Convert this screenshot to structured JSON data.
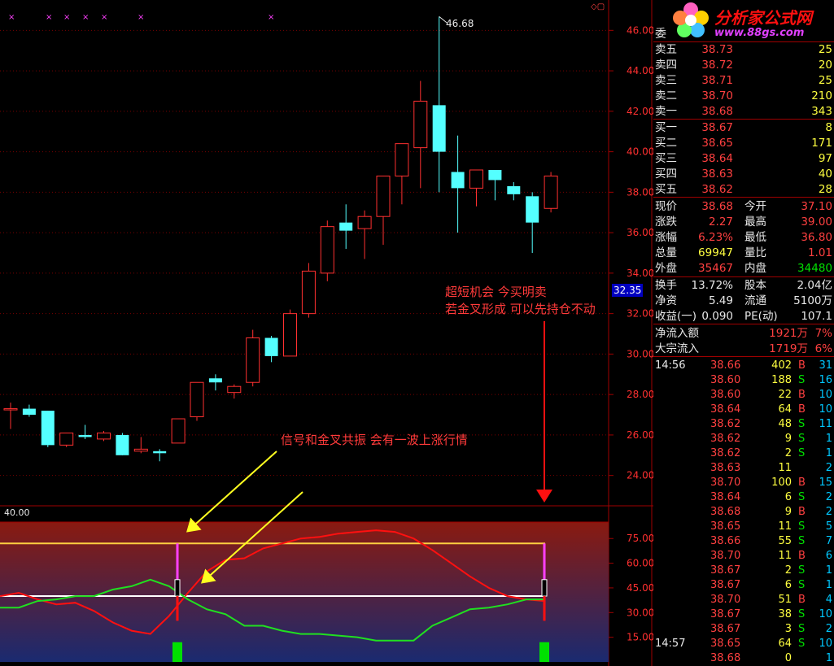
{
  "upper_axis": [
    "46.00",
    "44.00",
    "42.00",
    "40.00",
    "38.00",
    "36.00",
    "34.00",
    "32.00",
    "30.00",
    "28.00",
    "26.00",
    "24.00"
  ],
  "current_price_marker": "32.35",
  "peak_label": "46.68",
  "lower_axis": [
    "75.00",
    "60.00",
    "45.00",
    "30.00",
    "15.00"
  ],
  "lower_top_value": "40.00",
  "annotations": {
    "note_right_1": "超短机会  今买明卖",
    "note_right_2": "若金叉形成 可以先持仓不动",
    "note_left": "信号和金叉共振 会有一波上涨行情"
  },
  "logo": {
    "title": "分析家公式网",
    "url": "www.88gs.com"
  },
  "order_book_header": "委",
  "asks": [
    {
      "label": "卖五",
      "price": "38.73",
      "vol": "25"
    },
    {
      "label": "卖四",
      "price": "38.72",
      "vol": "20"
    },
    {
      "label": "卖三",
      "price": "38.71",
      "vol": "25"
    },
    {
      "label": "卖二",
      "price": "38.70",
      "vol": "210"
    },
    {
      "label": "卖一",
      "price": "38.68",
      "vol": "343"
    }
  ],
  "bids": [
    {
      "label": "买一",
      "price": "38.67",
      "vol": "8"
    },
    {
      "label": "买二",
      "price": "38.65",
      "vol": "171"
    },
    {
      "label": "买三",
      "price": "38.64",
      "vol": "97"
    },
    {
      "label": "买四",
      "price": "38.63",
      "vol": "40"
    },
    {
      "label": "买五",
      "price": "38.62",
      "vol": "28"
    }
  ],
  "quote": [
    {
      "l1": "现价",
      "v1": "38.68",
      "l2": "今开",
      "v2": "37.10",
      "c1": "red",
      "c2": "red"
    },
    {
      "l1": "涨跌",
      "v1": "2.27",
      "l2": "最高",
      "v2": "39.00",
      "c1": "red",
      "c2": "red"
    },
    {
      "l1": "涨幅",
      "v1": "6.23%",
      "l2": "最低",
      "v2": "36.80",
      "c1": "red",
      "c2": "red"
    },
    {
      "l1": "总量",
      "v1": "69947",
      "l2": "量比",
      "v2": "1.01",
      "c1": "yellow",
      "c2": "red"
    },
    {
      "l1": "外盘",
      "v1": "35467",
      "l2": "内盘",
      "v2": "34480",
      "c1": "red",
      "c2": "green"
    }
  ],
  "fund": [
    {
      "l1": "换手",
      "v1": "13.72%",
      "l2": "股本",
      "v2": "2.04亿"
    },
    {
      "l1": "净资",
      "v1": "5.49",
      "l2": "流通",
      "v2": "5100万"
    },
    {
      "l1": "收益(一)",
      "v1": "0.090",
      "l2": "PE(动)",
      "v2": "107.1"
    }
  ],
  "flows": [
    {
      "label": "净流入额",
      "value": "1921万",
      "pct": "7%"
    },
    {
      "label": "大宗流入",
      "value": "1719万",
      "pct": "6%"
    }
  ],
  "ticks": [
    {
      "time": "14:56",
      "price": "38.66",
      "vol": "402",
      "bs": "B",
      "n": "31"
    },
    {
      "time": "",
      "price": "38.60",
      "vol": "188",
      "bs": "S",
      "n": "16"
    },
    {
      "time": "",
      "price": "38.60",
      "vol": "22",
      "bs": "B",
      "n": "10"
    },
    {
      "time": "",
      "price": "38.64",
      "vol": "64",
      "bs": "B",
      "n": "10"
    },
    {
      "time": "",
      "price": "38.62",
      "vol": "48",
      "bs": "S",
      "n": "11"
    },
    {
      "time": "",
      "price": "38.62",
      "vol": "9",
      "bs": "S",
      "n": "1"
    },
    {
      "time": "",
      "price": "38.62",
      "vol": "2",
      "bs": "S",
      "n": "1"
    },
    {
      "time": "",
      "price": "38.63",
      "vol": "11",
      "bs": "",
      "n": "2"
    },
    {
      "time": "",
      "price": "38.70",
      "vol": "100",
      "bs": "B",
      "n": "15"
    },
    {
      "time": "",
      "price": "38.64",
      "vol": "6",
      "bs": "S",
      "n": "2"
    },
    {
      "time": "",
      "price": "38.68",
      "vol": "9",
      "bs": "B",
      "n": "2"
    },
    {
      "time": "",
      "price": "38.65",
      "vol": "11",
      "bs": "S",
      "n": "5"
    },
    {
      "time": "",
      "price": "38.66",
      "vol": "55",
      "bs": "S",
      "n": "7"
    },
    {
      "time": "",
      "price": "38.70",
      "vol": "11",
      "bs": "B",
      "n": "6"
    },
    {
      "time": "",
      "price": "38.67",
      "vol": "2",
      "bs": "S",
      "n": "1"
    },
    {
      "time": "",
      "price": "38.67",
      "vol": "6",
      "bs": "S",
      "n": "1"
    },
    {
      "time": "",
      "price": "38.70",
      "vol": "51",
      "bs": "B",
      "n": "4"
    },
    {
      "time": "",
      "price": "38.67",
      "vol": "38",
      "bs": "S",
      "n": "10"
    },
    {
      "time": "",
      "price": "38.67",
      "vol": "3",
      "bs": "S",
      "n": "2"
    },
    {
      "time": "14:57",
      "price": "38.65",
      "vol": "64",
      "bs": "S",
      "n": "10"
    },
    {
      "time": "",
      "price": "38.68",
      "vol": "0",
      "bs": "",
      "n": "1"
    }
  ],
  "chart_data": {
    "type": "candlestick",
    "ylim": [
      22.5,
      47.5
    ],
    "candles": [
      {
        "o": 27.3,
        "h": 27.6,
        "l": 26.3,
        "c": 27.3
      },
      {
        "o": 27.3,
        "h": 27.5,
        "l": 26.9,
        "c": 27.0
      },
      {
        "o": 27.2,
        "h": 27.2,
        "l": 25.4,
        "c": 25.5
      },
      {
        "o": 25.5,
        "h": 26.1,
        "l": 25.4,
        "c": 26.1
      },
      {
        "o": 26.0,
        "h": 26.5,
        "l": 25.8,
        "c": 25.9
      },
      {
        "o": 25.8,
        "h": 26.2,
        "l": 25.7,
        "c": 26.1
      },
      {
        "o": 26.0,
        "h": 26.1,
        "l": 25.0,
        "c": 25.0
      },
      {
        "o": 25.2,
        "h": 25.9,
        "l": 25.1,
        "c": 25.3
      },
      {
        "o": 25.2,
        "h": 25.3,
        "l": 24.7,
        "c": 25.1
      },
      {
        "o": 25.6,
        "h": 26.8,
        "l": 25.6,
        "c": 26.8
      },
      {
        "o": 26.9,
        "h": 28.6,
        "l": 26.7,
        "c": 28.6
      },
      {
        "o": 28.8,
        "h": 29.0,
        "l": 28.2,
        "c": 28.6
      },
      {
        "o": 28.1,
        "h": 28.5,
        "l": 27.8,
        "c": 28.4
      },
      {
        "o": 28.6,
        "h": 31.2,
        "l": 28.4,
        "c": 30.8
      },
      {
        "o": 30.8,
        "h": 30.9,
        "l": 29.6,
        "c": 29.9
      },
      {
        "o": 29.9,
        "h": 32.2,
        "l": 29.9,
        "c": 32.0
      },
      {
        "o": 32.0,
        "h": 34.5,
        "l": 31.8,
        "c": 34.1
      },
      {
        "o": 34.0,
        "h": 36.6,
        "l": 33.6,
        "c": 36.3
      },
      {
        "o": 36.5,
        "h": 37.4,
        "l": 35.2,
        "c": 36.1
      },
      {
        "o": 36.2,
        "h": 37.1,
        "l": 34.7,
        "c": 36.8
      },
      {
        "o": 36.8,
        "h": 38.6,
        "l": 35.4,
        "c": 38.8
      },
      {
        "o": 38.8,
        "h": 40.3,
        "l": 37.4,
        "c": 40.4
      },
      {
        "o": 40.2,
        "h": 43.5,
        "l": 38.2,
        "c": 42.5
      },
      {
        "o": 42.3,
        "h": 46.68,
        "l": 38.0,
        "c": 40.0
      },
      {
        "o": 39.0,
        "h": 40.8,
        "l": 36.0,
        "c": 38.2
      },
      {
        "o": 38.2,
        "h": 39.1,
        "l": 37.3,
        "c": 39.1
      },
      {
        "o": 39.1,
        "h": 39.1,
        "l": 37.6,
        "c": 38.6
      },
      {
        "o": 38.3,
        "h": 38.5,
        "l": 37.6,
        "c": 37.9
      },
      {
        "o": 37.8,
        "h": 38.0,
        "l": 35.0,
        "c": 36.5
      },
      {
        "o": 37.2,
        "h": 39.0,
        "l": 37.0,
        "c": 38.8
      }
    ],
    "indicator": {
      "ylim": [
        0,
        85
      ],
      "level_lines": [
        72,
        40
      ],
      "red_line": [
        40,
        42,
        38,
        35,
        36,
        31,
        24,
        19,
        17,
        28,
        42,
        55,
        62,
        63,
        69,
        72,
        75,
        76,
        78,
        79,
        80,
        79,
        75,
        68,
        60,
        52,
        45,
        40,
        38,
        37
      ],
      "green_line": [
        33,
        33,
        37,
        38,
        40,
        40,
        44,
        46,
        50,
        46,
        38,
        32,
        29,
        22,
        22,
        19,
        17,
        17,
        16,
        15,
        13,
        13,
        13,
        22,
        27,
        32,
        33,
        35,
        38,
        38
      ]
    }
  }
}
